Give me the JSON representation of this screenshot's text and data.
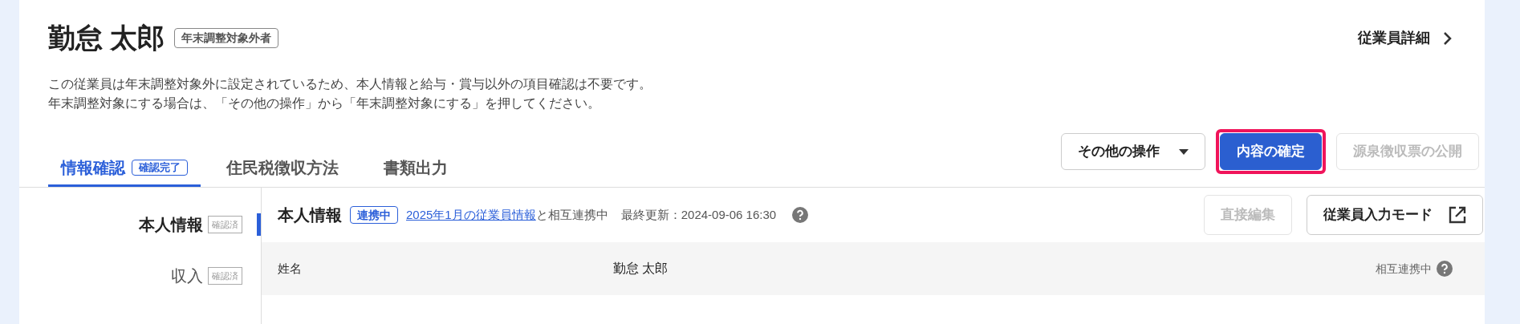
{
  "employee": {
    "name": "勤怠 太郎",
    "badge": "年末調整対象外者",
    "detail_link": "従業員詳細"
  },
  "notice": [
    "この従業員は年末調整対象外に設定されているため、本人情報と給与・賞与以外の項目確認は不要です。",
    "年末調整対象にする場合は、「その他の操作」から「年末調整対象にする」を押してください。"
  ],
  "tabs": [
    {
      "label": "情報確認",
      "badge": "確認完了",
      "selected": true
    },
    {
      "label": "住民税徴収方法",
      "selected": false
    },
    {
      "label": "書類出力",
      "selected": false
    }
  ],
  "actions": [
    {
      "label": "その他の操作",
      "kind": "dropdown",
      "disabled": false,
      "highlighted": false
    },
    {
      "label": "内容の確定",
      "kind": "primary",
      "disabled": false,
      "highlighted": true
    },
    {
      "label": "源泉徴収票の公開",
      "kind": "secondary",
      "disabled": true,
      "highlighted": false
    }
  ],
  "sidebar": {
    "items": [
      {
        "label": "本人情報",
        "badge": "確認済",
        "selected": true
      },
      {
        "label": "収入",
        "badge": "確認済",
        "selected": false
      }
    ]
  },
  "section": {
    "title": "本人情報",
    "badge": "連携中",
    "link": "2025年1月の従業員情報",
    "link_suffix": "と相互連携中",
    "updated": "最終更新：2024-09-06 16:30",
    "buttons": [
      {
        "label": "直接編集",
        "kind": "plain",
        "disabled": true
      },
      {
        "label": "従業員入力モード",
        "kind": "external",
        "disabled": false
      }
    ]
  },
  "rows": [
    {
      "label": "姓名",
      "value": "勤怠 太郎",
      "status": "相互連携中"
    }
  ]
}
